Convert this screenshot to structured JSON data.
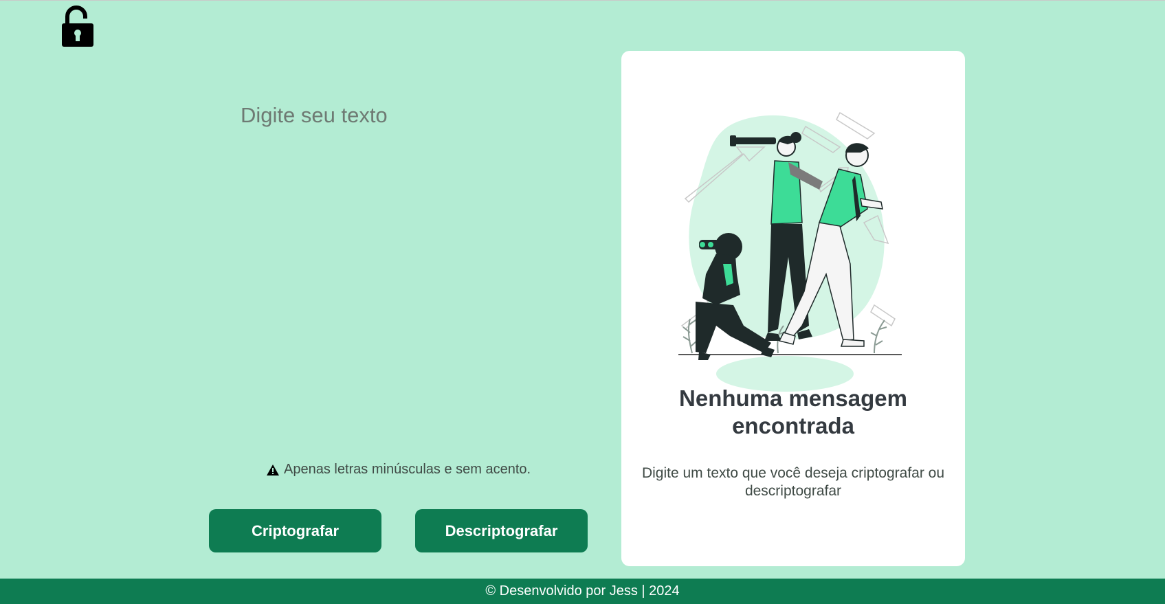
{
  "header": {
    "logo_icon": "unlocked-padlock-icon"
  },
  "input": {
    "placeholder": "Digite seu texto",
    "value": ""
  },
  "warning": {
    "icon": "warning-triangle-icon",
    "text": "Apenas letras minúsculas e sem acento."
  },
  "actions": {
    "encrypt_label": "Criptografar",
    "decrypt_label": "Descriptografar"
  },
  "output_panel": {
    "illustration": "people-searching-illustration",
    "title": "Nenhuma mensagem encontrada",
    "subtitle": "Digite um texto que você deseja criptografar ou descriptografar"
  },
  "footer": {
    "text": "© Desenvolvido por Jess | 2024"
  },
  "colors": {
    "background": "#b3ecd3",
    "primary": "#0e7c52",
    "card": "#ffffff",
    "title_text": "#343a40"
  }
}
